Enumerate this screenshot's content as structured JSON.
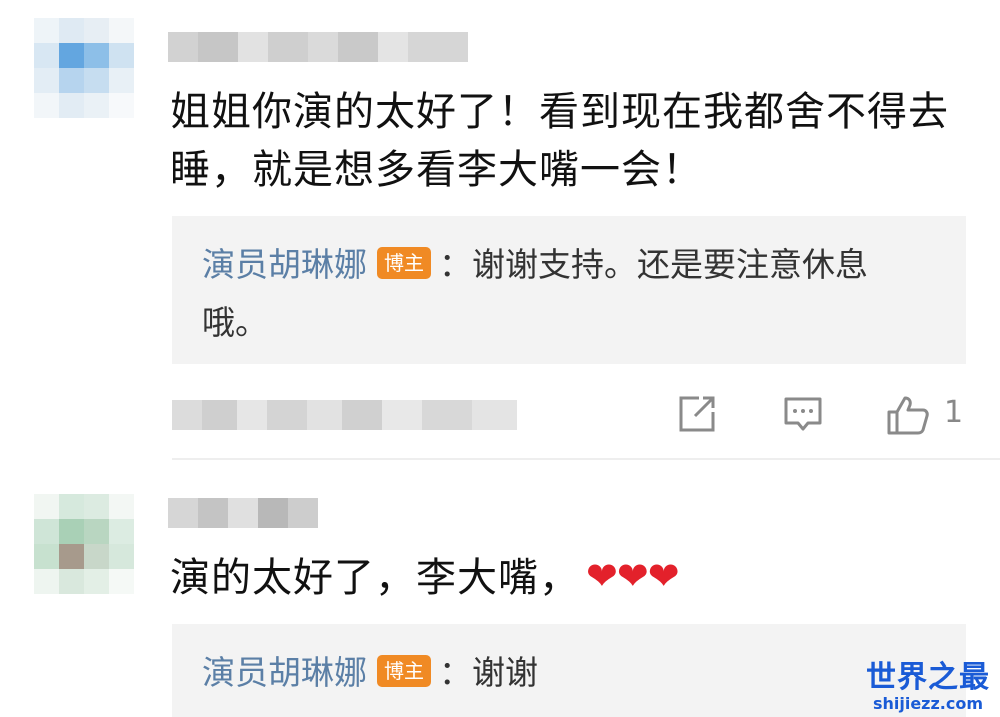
{
  "comments": [
    {
      "text": "姐姐你演的太好了！看到现在我都舍不得去睡，就是想多看李大嘴一会！",
      "reply": {
        "author": "演员胡琳娜",
        "badge": "博主",
        "separator": "：",
        "text": "谢谢支持。还是要注意休息哦。"
      },
      "actions": {
        "like_count": "1"
      }
    },
    {
      "text": "演的太好了，李大嘴，",
      "emoji": "❤❤❤",
      "reply": {
        "author": "演员胡琳娜",
        "badge": "博主",
        "separator": "：",
        "text": "谢谢"
      }
    }
  ],
  "icons": {
    "share": "share-icon",
    "comment": "comment-icon",
    "like": "thumbs-up-icon"
  },
  "colors": {
    "author_link": "#5b7fa6",
    "badge": "#f08a24",
    "heart": "#e3212b",
    "watermark": "#1a5bd6"
  },
  "watermark": {
    "cn": "世界之最",
    "en": "shijiezz.com"
  }
}
